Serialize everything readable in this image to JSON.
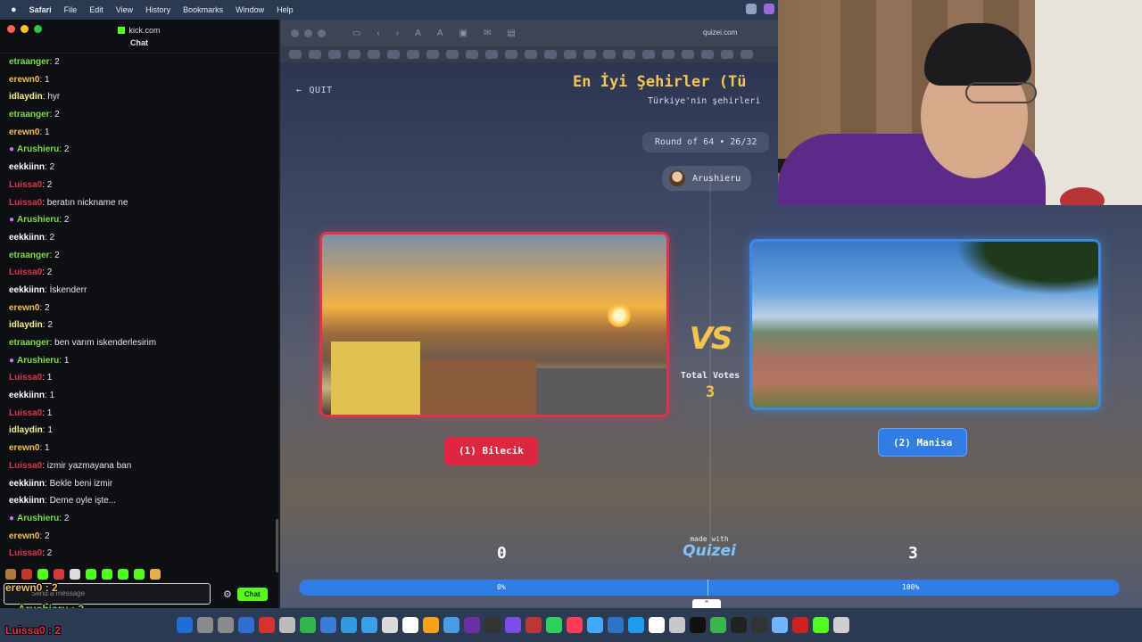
{
  "menubar": {
    "app": "Safari",
    "items": [
      "File",
      "Edit",
      "View",
      "History",
      "Bookmarks",
      "Window",
      "Help"
    ]
  },
  "chat": {
    "window_url": "kick.com",
    "title": "Chat",
    "messages": [
      {
        "user": "etraanger",
        "text": ": 2",
        "color": "#7ddc4d",
        "mic": false
      },
      {
        "user": "erewn0",
        "text": ": 1",
        "color": "#f0c14d",
        "mic": false
      },
      {
        "user": "idlaydin",
        "text": ": hyr",
        "color": "#f4f08a",
        "mic": false
      },
      {
        "user": "etraanger",
        "text": ": 2",
        "color": "#7ddc4d",
        "mic": false
      },
      {
        "user": "erewn0",
        "text": ": 1",
        "color": "#f0c14d",
        "mic": false
      },
      {
        "user": "Arushieru",
        "text": ": 2",
        "color": "#7ddc4d",
        "mic": true
      },
      {
        "user": "eekkiinn",
        "text": ": 2",
        "color": "#ffffff",
        "mic": false
      },
      {
        "user": "Luissa0",
        "text": ": 2",
        "color": "#e0334b",
        "mic": false
      },
      {
        "user": "Luissa0",
        "text": ": beratın nickname ne",
        "color": "#e0334b",
        "mic": false
      },
      {
        "user": "Arushieru",
        "text": ": 2",
        "color": "#7ddc4d",
        "mic": true
      },
      {
        "user": "eekkiinn",
        "text": ": 2",
        "color": "#ffffff",
        "mic": false
      },
      {
        "user": "etraanger",
        "text": ": 2",
        "color": "#7ddc4d",
        "mic": false
      },
      {
        "user": "Luissa0",
        "text": ": 2",
        "color": "#e0334b",
        "mic": false
      },
      {
        "user": "eekkiinn",
        "text": ": İskenderr",
        "color": "#ffffff",
        "mic": false
      },
      {
        "user": "erewn0",
        "text": ": 2",
        "color": "#f0c14d",
        "mic": false
      },
      {
        "user": "idlaydin",
        "text": ": 2",
        "color": "#f4f08a",
        "mic": false
      },
      {
        "user": "etraanger",
        "text": ": ben varım iskenderlesirim",
        "color": "#7ddc4d",
        "mic": false
      },
      {
        "user": "Arushieru",
        "text": ": 1",
        "color": "#7ddc4d",
        "mic": true
      },
      {
        "user": "Luissa0",
        "text": ": 1",
        "color": "#e0334b",
        "mic": false
      },
      {
        "user": "eekkiinn",
        "text": ": 1",
        "color": "#ffffff",
        "mic": false
      },
      {
        "user": "Luissa0",
        "text": ": 1",
        "color": "#e0334b",
        "mic": false
      },
      {
        "user": "idlaydin",
        "text": ": 1",
        "color": "#f4f08a",
        "mic": false
      },
      {
        "user": "erewn0",
        "text": ": 1",
        "color": "#f0c14d",
        "mic": false
      },
      {
        "user": "Luissa0",
        "text": ": izmir yazmayana ban",
        "color": "#e0334b",
        "mic": false
      },
      {
        "user": "eekkiinn",
        "text": ": Bekle beni izmir",
        "color": "#ffffff",
        "mic": false
      },
      {
        "user": "eekkiinn",
        "text": ": Deme oyle işte...",
        "color": "#ffffff",
        "mic": false
      },
      {
        "user": "Arushieru",
        "text": ": 2",
        "color": "#7ddc4d",
        "mic": true
      },
      {
        "user": "erewn0",
        "text": ": 2",
        "color": "#f0c14d",
        "mic": false
      },
      {
        "user": "Luissa0",
        "text": ": 2",
        "color": "#e0334b",
        "mic": false
      }
    ],
    "input_placeholder": "Send a message",
    "send_label": "Chat"
  },
  "overlay": {
    "lines": [
      {
        "text": "erewn0 : 2",
        "color": "#f0c14d"
      },
      {
        "text": "Arushieru : 2",
        "color": "#7ddc4d"
      },
      {
        "text": "Luissa0 : 2",
        "color": "#e0334b"
      }
    ]
  },
  "browser": {
    "url": "quizei.com"
  },
  "quiz": {
    "quit_label": "QUIT",
    "title": "En İyi Şehirler (Tü",
    "subtitle": "Türkiye'nin şehirleri",
    "round": "Round of 64 • 26/32",
    "player": "Arushieru",
    "vs": "VS",
    "total_votes_label": "Total Votes",
    "total_votes": "3",
    "option_left": "(1) Bilecik",
    "option_right": "(2) Manisa",
    "score_left": "0",
    "score_right": "3",
    "made_with": "made with",
    "brand": "Quizei",
    "progress_left_label": "0%",
    "progress_right_label": "100%",
    "progress_left_fraction": 0.0
  },
  "colors": {
    "accent_red": "#e0263f",
    "accent_blue": "#2f7de6",
    "title_gold": "#f4c64d",
    "kick_green": "#53fc18"
  }
}
